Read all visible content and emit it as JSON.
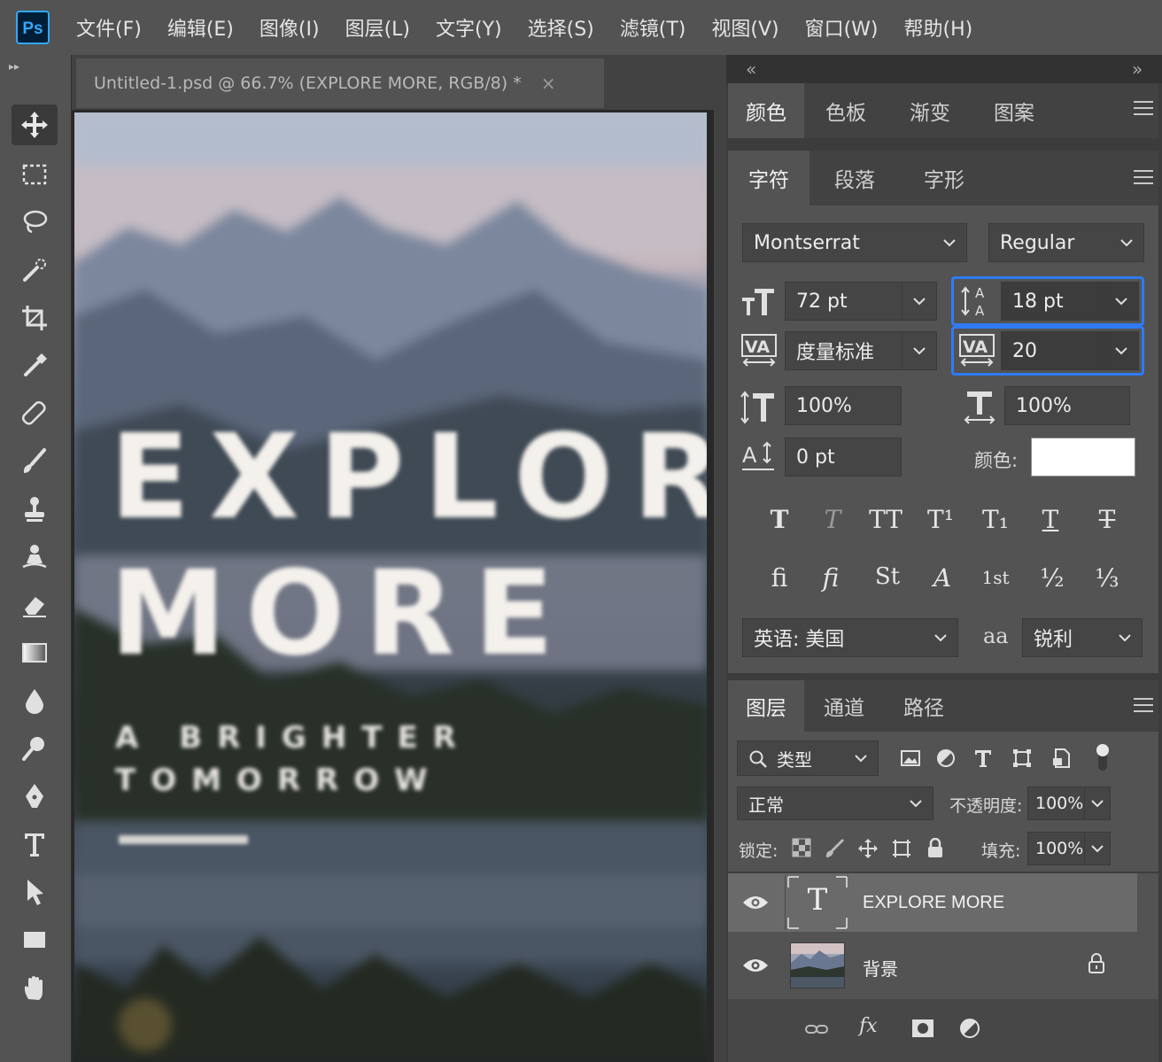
{
  "app": {
    "logo_text": "Ps",
    "accent_color": "#31a8ff"
  },
  "menu": {
    "items": [
      "文件(F)",
      "编辑(E)",
      "图像(I)",
      "图层(L)",
      "文字(Y)",
      "选择(S)",
      "滤镜(T)",
      "视图(V)",
      "窗口(W)",
      "帮助(H)"
    ]
  },
  "toolbar": {
    "collapse_glyph": "▸▸",
    "tools": [
      "move-icon",
      "marquee-icon",
      "lasso-icon",
      "quick-select-icon",
      "crop-icon",
      "eyedropper-icon",
      "healing-brush-icon",
      "brush-icon",
      "clone-stamp-icon",
      "history-brush-icon",
      "eraser-icon",
      "gradient-icon",
      "blur-icon",
      "dodge-icon",
      "pen-icon",
      "type-icon",
      "path-select-icon",
      "rectangle-icon",
      "hand-icon"
    ],
    "active_tool": "move-icon"
  },
  "document": {
    "tab_title": "Untitled-1.psd @ 66.7% (EXPLORE MORE, RGB/8) *",
    "tab_close": "×",
    "canvas_text": {
      "line1": "EXPLORE",
      "line2": "MORE",
      "sub1": "A BRIGHTER",
      "sub2": "TOMORROW"
    }
  },
  "panels": {
    "collapse_left": "«",
    "collapse_right": "»",
    "color_tabs": [
      "颜色",
      "色板",
      "渐变",
      "图案"
    ],
    "char_tabs": [
      "字符",
      "段落",
      "字形"
    ],
    "character": {
      "font_family": "Montserrat",
      "font_style": "Regular",
      "font_size": "72 pt",
      "leading": "18 pt",
      "kerning": "度量标准",
      "tracking": "20",
      "vertical_scale": "100%",
      "horizontal_scale": "100%",
      "baseline_shift": "0 pt",
      "color_label": "颜色:",
      "color_value": "#ffffff",
      "style_buttons": [
        "T",
        "T",
        "TT",
        "T¹",
        "T₁",
        "T",
        "T"
      ],
      "opentype_buttons": [
        "fi",
        "ﬁ",
        "St",
        "A",
        "1st",
        "½",
        "⅓"
      ],
      "language": "英语: 美国",
      "aa_glyph": "aa",
      "antialias": "锐利"
    },
    "layer_tabs": [
      "图层",
      "通道",
      "路径"
    ],
    "layers": {
      "filter_label": "类型",
      "blend_mode": "正常",
      "opacity_label": "不透明度:",
      "opacity": "100%",
      "lock_label": "锁定:",
      "fill_label": "填充:",
      "fill": "100%",
      "items": [
        {
          "name": "EXPLORE MORE",
          "type_glyph": "T",
          "selected": true
        },
        {
          "name": "背景",
          "locked": true
        }
      ],
      "footer_fx": "fx"
    }
  }
}
